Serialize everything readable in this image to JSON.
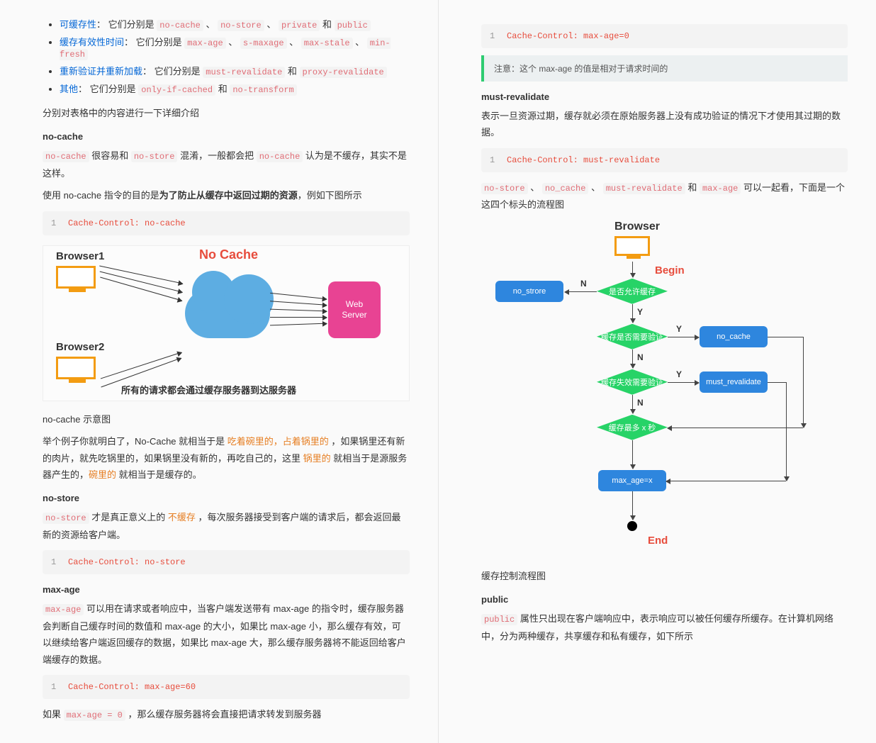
{
  "left": {
    "list": [
      {
        "label": "可缓存性",
        "tail": "： 它们分别是 ",
        "codes": [
          "no-cache",
          "no-store",
          "private",
          "public"
        ],
        "joiner": " 、 ",
        "last_joiner": " 和 "
      },
      {
        "label": "缓存有效性时间",
        "tail": "： 它们分别是 ",
        "codes": [
          "max-age",
          "s-maxage",
          "max-stale",
          "min-fresh"
        ],
        "joiner": " 、 ",
        "last_joiner": " 、 "
      },
      {
        "label": "重新验证并重新加载",
        "tail": "： 它们分别是 ",
        "codes": [
          "must-revalidate",
          "proxy-revalidate"
        ],
        "joiner": " 和 ",
        "last_joiner": " 和 "
      },
      {
        "label": "其他",
        "tail": "： 它们分别是 ",
        "codes": [
          "only-if-cached",
          "no-transform"
        ],
        "joiner": " 和 ",
        "last_joiner": " 和 "
      }
    ],
    "intro": "分别对表格中的内容进行一下详细介绍",
    "h_nocache": "no-cache",
    "nocache_p1_a": "no-cache",
    "nocache_p1_b": " 很容易和 ",
    "nocache_p1_c": "no-store",
    "nocache_p1_d": " 混淆，一般都会把 ",
    "nocache_p1_e": "no-cache",
    "nocache_p1_f": " 认为是不缓存，其实不是这样。",
    "nocache_p2_a": "使用 no-cache 指令的目的是",
    "nocache_p2_b": "为了防止从缓存中返回过期的资源",
    "nocache_p2_c": "，例如下图所示",
    "code_nocache": {
      "ln": "1",
      "txt": "Cache-Control: no-cache"
    },
    "diagram1": {
      "title": "No Cache",
      "browser1": "Browser1",
      "browser2": "Browser2",
      "server": "Web\nServer",
      "caption": "所有的请求都会通过缓存服务器到达服务器"
    },
    "nocache_caption": "no-cache 示意图",
    "nocache_ex_a": "举个例子你就明白了，No-Cache 就相当于是 ",
    "nocache_ex_b": "吃着碗里的，占着锅里的",
    "nocache_ex_c": " ，如果锅里还有新的肉片，就先吃锅里的，如果锅里没有新的，再吃自己的，这里 ",
    "nocache_ex_d": "锅里的",
    "nocache_ex_e": " 就相当于是源服务器产生的，",
    "nocache_ex_f": "碗里的",
    "nocache_ex_g": " 就相当于是缓存的。",
    "h_nostore": "no-store",
    "nostore_p_a": "no-store",
    "nostore_p_b": " 才是真正意义上的 ",
    "nostore_p_c": "不缓存",
    "nostore_p_d": " ，每次服务器接受到客户端的请求后，都会返回最新的资源给客户端。",
    "code_nostore": {
      "ln": "1",
      "txt": "Cache-Control: no-store"
    },
    "h_maxage": "max-age",
    "maxage_p_a": "max-age",
    "maxage_p_b": " 可以用在请求或者响应中，当客户端发送带有 max-age 的指令时，缓存服务器会判断自己缓存时间的数值和 max-age 的大小，如果比 max-age 小，那么缓存有效，可以继续给客户端返回缓存的数据，如果比 max-age 大，那么缓存服务器将不能返回给客户端缓存的数据。",
    "code_maxage": {
      "ln": "1",
      "txt": "Cache-Control: max-age=60"
    },
    "maxage_tail_a": "如果 ",
    "maxage_tail_b": "max-age = 0",
    "maxage_tail_c": " ，那么缓存服务器将会直接把请求转发到服务器"
  },
  "right": {
    "code_maxage0": {
      "ln": "1",
      "txt": "Cache-Control: max-age=0"
    },
    "tip": "注意：这个 max-age 的值是相对于请求时间的",
    "h_mustrev": "must-revalidate",
    "mustrev_p": "表示一旦资源过期，缓存就必须在原始服务器上没有成功验证的情况下才使用其过期的数据。",
    "code_mustrev": {
      "ln": "1",
      "txt": "Cache-Control: must-revalidate"
    },
    "combo_a": "no-store",
    "combo_b": "no_cache",
    "combo_c": "must-revalidate",
    "combo_d": "max-age",
    "combo_tail": " 可以一起看，下面是一个这四个标头的流程图",
    "diagram2": {
      "browser": "Browser",
      "begin": "Begin",
      "end": "End",
      "d1": "是否允许缓存",
      "d2": "缓存是否需要验证",
      "d3": "缓存失效需要验证",
      "d4": "缓存最多 x 秒",
      "r_nostore": "no_strore",
      "r_nocache": "no_cache",
      "r_mustrev": "must_revalidate",
      "r_maxage": "max_age=x",
      "Y": "Y",
      "N": "N"
    },
    "d2_caption": "缓存控制流程图",
    "h_public": "public",
    "public_a": "public",
    "public_b": " 属性只出现在客户端响应中，表示响应可以被任何缓存所缓存。在计算机网络中，分为两种缓存，共享缓存和私有缓存，如下所示"
  }
}
